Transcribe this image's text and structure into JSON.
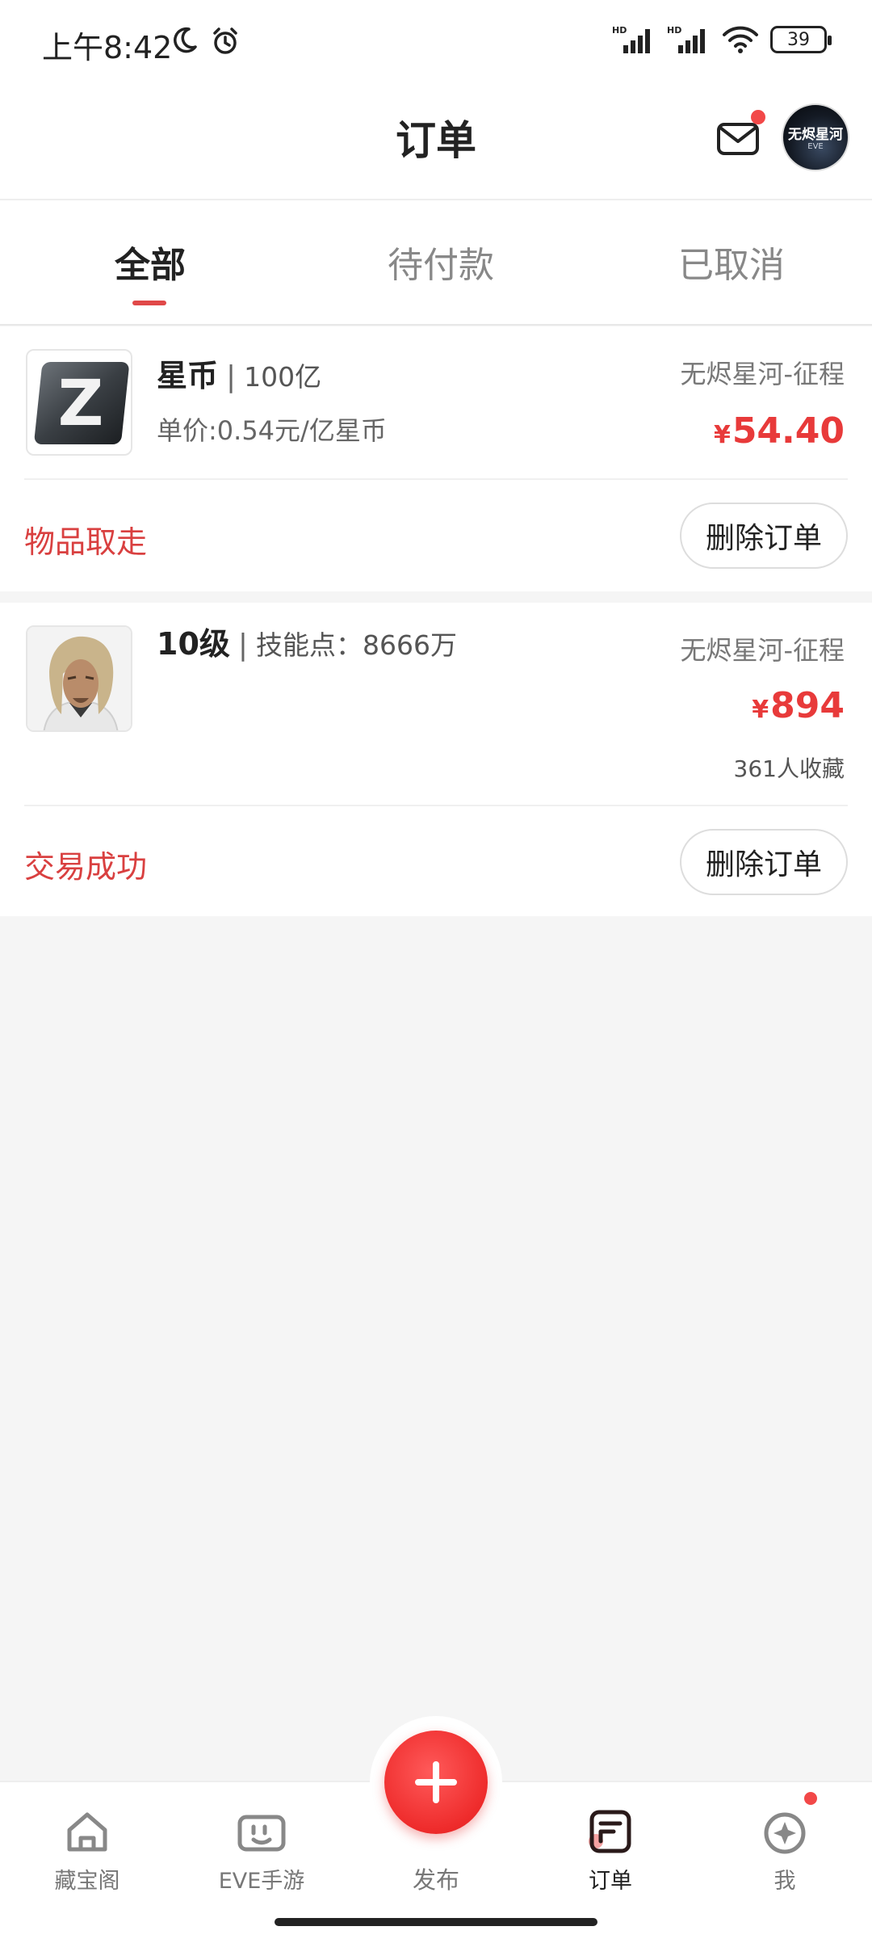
{
  "status_bar": {
    "time": "上午8:42",
    "battery": "39",
    "signal_label_1": "HD",
    "signal_label_2": "HD"
  },
  "header": {
    "title": "订单",
    "avatar_text": "无烬星河",
    "avatar_sub": "EVE"
  },
  "tabs": [
    {
      "label": "全部",
      "active": true
    },
    {
      "label": "待付款",
      "active": false
    },
    {
      "label": "已取消",
      "active": false
    }
  ],
  "orders": [
    {
      "title": "星币",
      "subtitle": "100亿",
      "unit_price": "单价:0.54元/亿星币",
      "game": "无烬星河-征程",
      "currency": "¥",
      "price": "54.40",
      "status": "物品取走",
      "delete_label": "删除订单"
    },
    {
      "title": "10级",
      "subtitle": "技能点：8666万",
      "game": "无烬星河-征程",
      "currency": "¥",
      "price": "894",
      "favorites": "361人收藏",
      "status": "交易成功",
      "delete_label": "删除订单"
    }
  ],
  "bottom_nav": [
    {
      "label": "藏宝阁",
      "icon": "home-icon"
    },
    {
      "label": "EVE手游",
      "icon": "gamepad-icon"
    },
    {
      "label": "发布",
      "icon": "plus-icon"
    },
    {
      "label": "订单",
      "icon": "order-icon",
      "active": true
    },
    {
      "label": "我",
      "icon": "compass-icon"
    }
  ],
  "colors": {
    "accent": "#e83a3a",
    "status": "#d94040"
  }
}
